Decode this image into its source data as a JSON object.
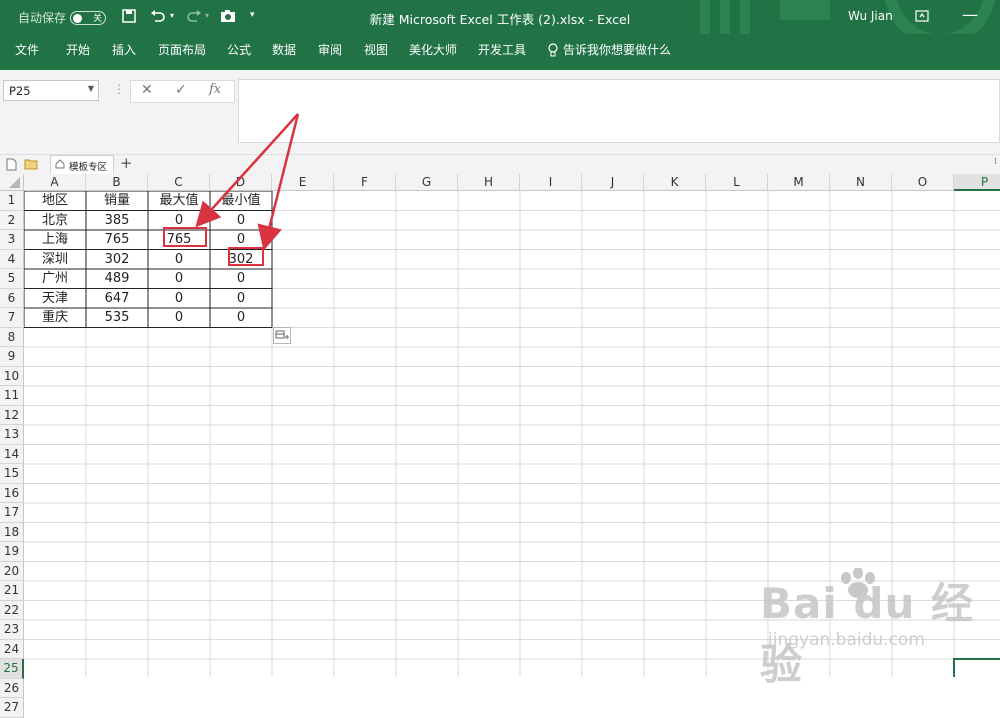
{
  "titlebar": {
    "autosave_label": "自动保存",
    "autosave_state": "关",
    "title": "新建 Microsoft Excel 工作表 (2).xlsx  -  Excel",
    "user": "Wu Jian"
  },
  "ribbon": {
    "tabs": [
      "文件",
      "开始",
      "插入",
      "页面布局",
      "公式",
      "数据",
      "审阅",
      "视图",
      "美化大师",
      "开发工具"
    ],
    "tell_me": "告诉我你想要做什么"
  },
  "formula_bar": {
    "name_box": "P25",
    "cancel": "✕",
    "enter": "✓",
    "fx": "fx",
    "content": ""
  },
  "sheet_tab": {
    "label": "模板专区",
    "add": "+"
  },
  "columns": [
    "A",
    "B",
    "C",
    "D",
    "E",
    "F",
    "G",
    "H",
    "I",
    "J",
    "K",
    "L",
    "M",
    "N",
    "O",
    "P"
  ],
  "rows": [
    "1",
    "2",
    "3",
    "4",
    "5",
    "6",
    "7",
    "8",
    "9",
    "10",
    "11",
    "12",
    "13",
    "14",
    "15",
    "16",
    "17",
    "18",
    "19",
    "20",
    "21",
    "22",
    "23",
    "24",
    "25",
    "26",
    "27"
  ],
  "table": {
    "headers": [
      "地区",
      "销量",
      "最大值",
      "最小值"
    ],
    "rows": [
      [
        "北京",
        "385",
        "0",
        "0"
      ],
      [
        "上海",
        "765",
        "765",
        "0"
      ],
      [
        "深圳",
        "302",
        "0",
        "302"
      ],
      [
        "广州",
        "489",
        "0",
        "0"
      ],
      [
        "天津",
        "647",
        "0",
        "0"
      ],
      [
        "重庆",
        "535",
        "0",
        "0"
      ]
    ]
  },
  "selected_cell": "P25",
  "annotation_color": "#d9333f",
  "watermark": {
    "logo": "Bai du 经验",
    "url": "jingyan.baidu.com"
  }
}
